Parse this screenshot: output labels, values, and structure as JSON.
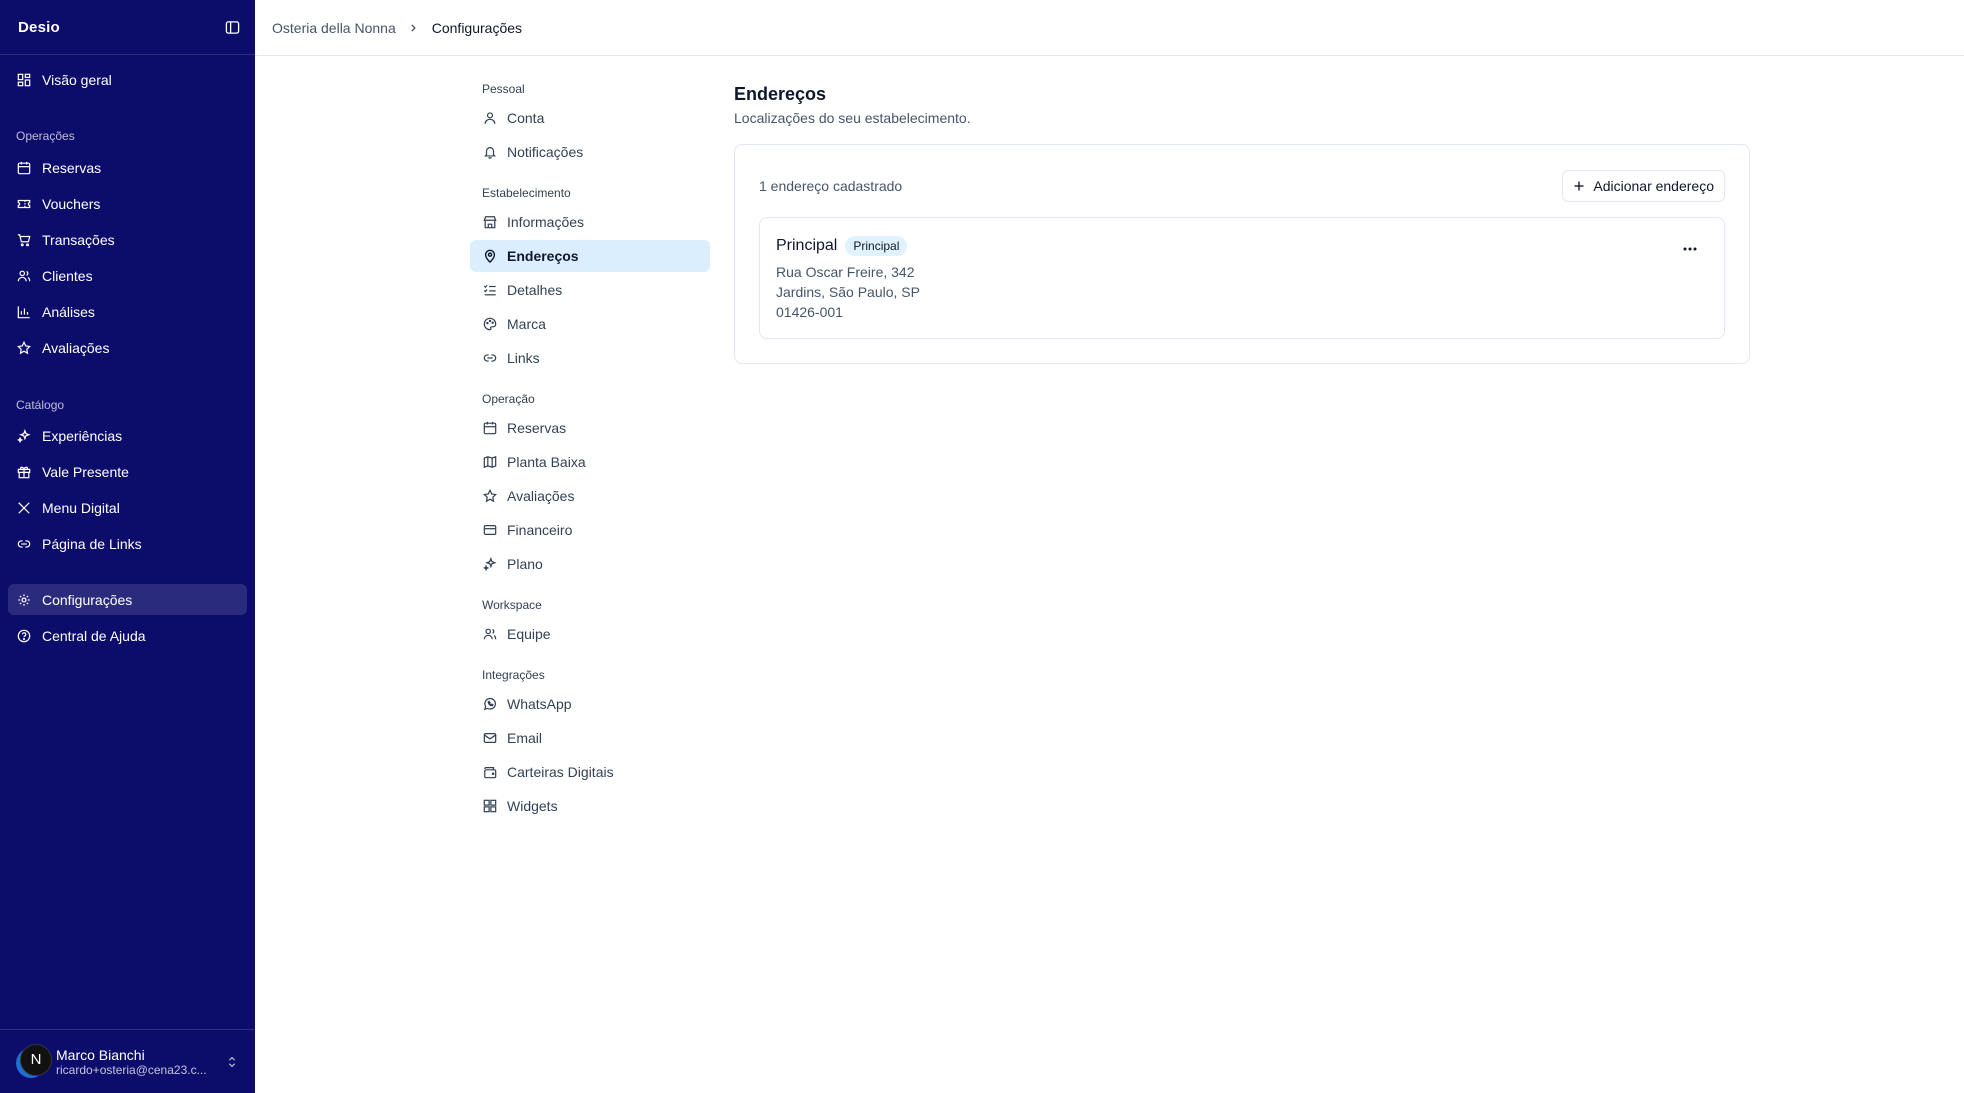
{
  "sidebar": {
    "logo": "Desio",
    "items": {
      "overview": "Visão geral",
      "operations_title": "Operações",
      "reservas": "Reservas",
      "vouchers": "Vouchers",
      "transacoes": "Transações",
      "clientes": "Clientes",
      "analises": "Análises",
      "avaliacoes": "Avaliações",
      "catalog_title": "Catálogo",
      "experiencias": "Experiências",
      "vale_presente": "Vale Presente",
      "menu_digital": "Menu Digital",
      "pagina_links": "Página de Links",
      "configuracoes": "Configurações",
      "central_ajuda": "Central de Ajuda"
    },
    "user": {
      "initial": "N",
      "name": "Marco Bianchi",
      "email": "ricardo+osteria@cena23.c..."
    }
  },
  "breadcrumb": {
    "parent": "Osteria della Nonna",
    "current": "Configurações"
  },
  "settings_nav": {
    "pessoal_title": "Pessoal",
    "conta": "Conta",
    "notificacoes": "Notificações",
    "estabelecimento_title": "Estabelecimento",
    "informacoes": "Informações",
    "enderecos": "Endereços",
    "detalhes": "Detalhes",
    "marca": "Marca",
    "links": "Links",
    "operacao_title": "Operação",
    "reservas": "Reservas",
    "planta_baixa": "Planta Baixa",
    "avaliacoes": "Avaliações",
    "financeiro": "Financeiro",
    "plano": "Plano",
    "workspace_title": "Workspace",
    "equipe": "Equipe",
    "integracoes_title": "Integrações",
    "whatsapp": "WhatsApp",
    "email": "Email",
    "carteiras_digitais": "Carteiras Digitais",
    "widgets": "Widgets"
  },
  "content": {
    "title": "Endereços",
    "subtitle": "Localizações do seu estabelecimento.",
    "count_text": "1 endereço cadastrado",
    "add_button": "Adicionar endereço",
    "address": {
      "name": "Principal",
      "badge": "Principal",
      "line1": "Rua Oscar Freire, 342",
      "line2": "Jardins, São Paulo, SP",
      "line3": "01426-001"
    }
  }
}
